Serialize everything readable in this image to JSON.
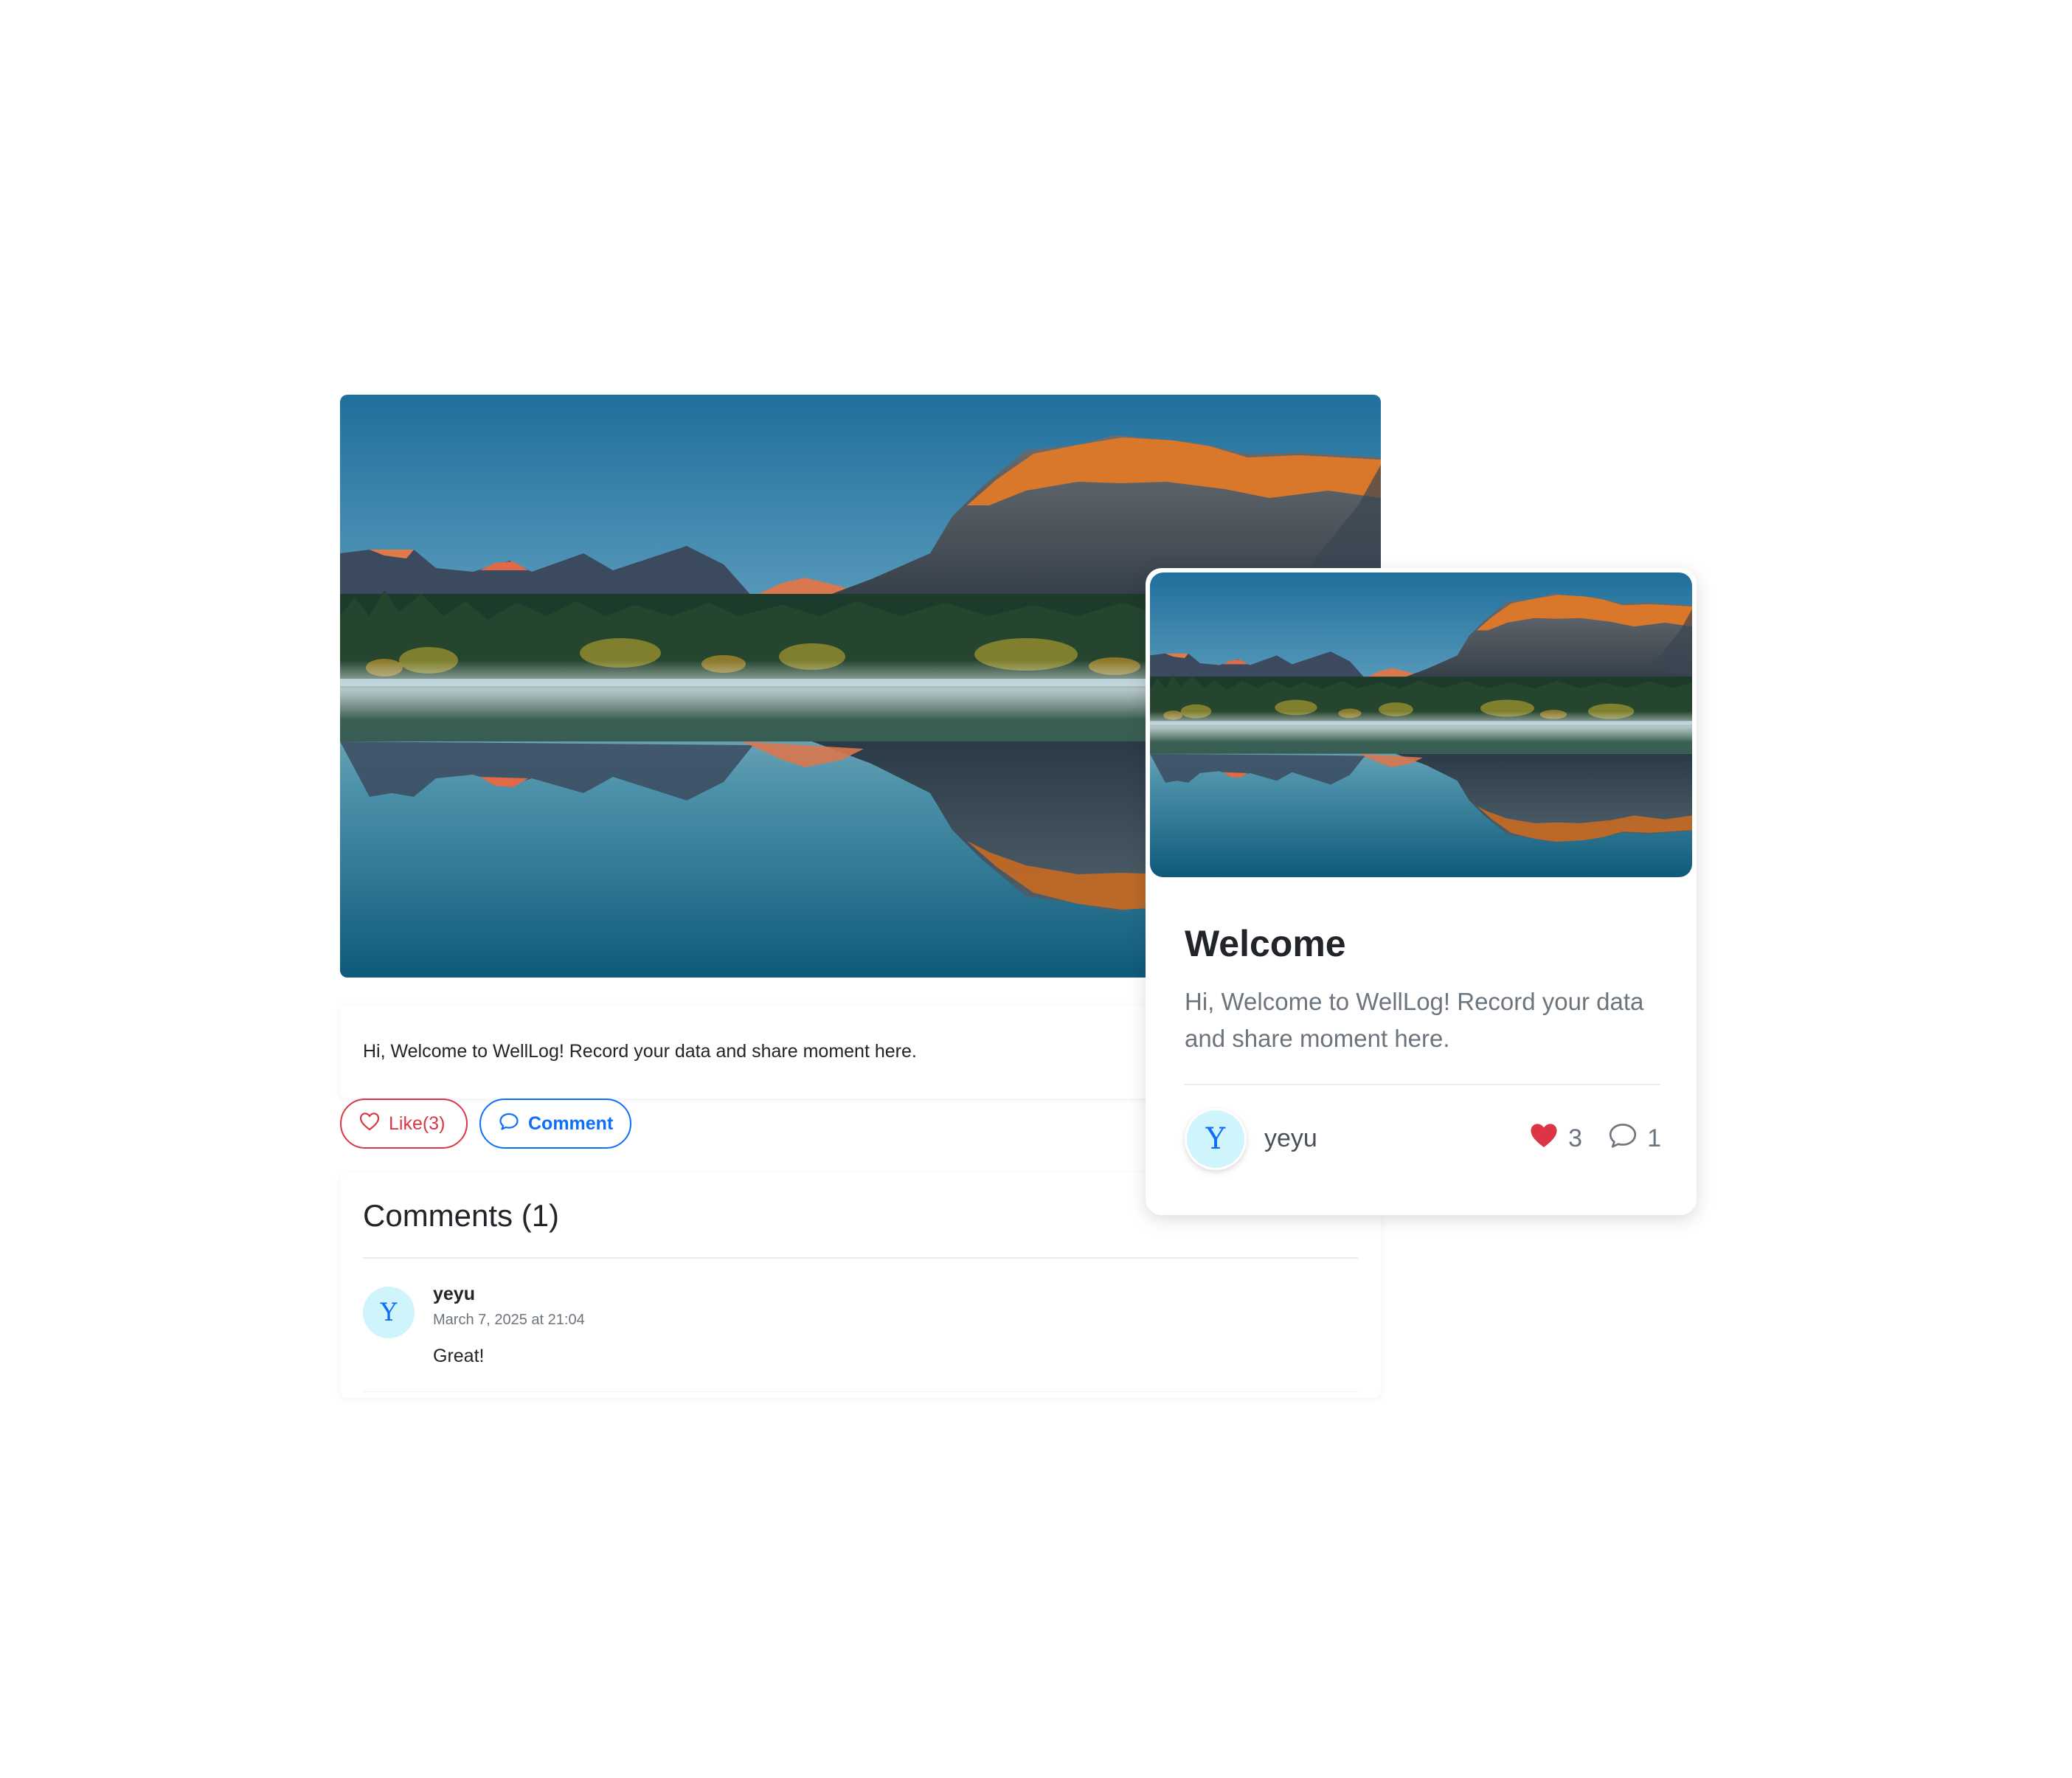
{
  "post": {
    "body": "Hi, Welcome to WellLog! Record your data and share moment here.",
    "like_label": "Like(3)",
    "comment_label": "Comment"
  },
  "comments": {
    "title": "Comments (1)",
    "items": [
      {
        "avatar_letter": "Y",
        "author": "yeyu",
        "time": "March 7, 2025 at 21:04",
        "text": "Great!"
      }
    ]
  },
  "preview": {
    "title": "Welcome",
    "description": "Hi, Welcome to WellLog! Record your data and share moment here.",
    "avatar_letter": "Y",
    "author": "yeyu",
    "likes": "3",
    "comments": "1"
  },
  "colors": {
    "like": "#dc3545",
    "primary": "#0d6efd",
    "avatar_bg": "#cff4fc",
    "muted": "#6c757d"
  },
  "icons": {
    "like": "heart-outline-icon",
    "comment": "chat-bubble-icon",
    "preview_like": "heart-filled-icon",
    "preview_comment": "chat-bubble-icon"
  }
}
